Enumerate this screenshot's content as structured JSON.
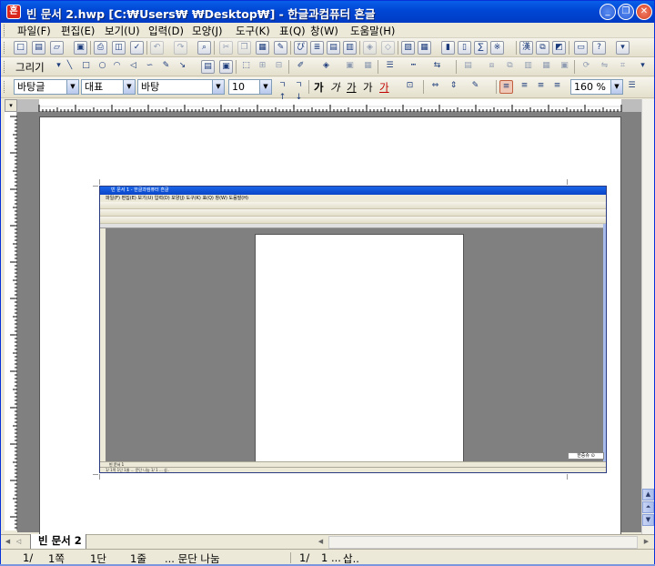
{
  "window": {
    "title": "빈 문서 2.hwp [C:₩Users₩    ₩Desktop₩] - 한글과컴퓨터 흔글",
    "app_icon_letter": "흔"
  },
  "menu": [
    "파일(F)",
    "편집(E)",
    "보기(U)",
    "입력(D)",
    "모양(J)",
    "도구(K)",
    "표(Q)",
    "창(W)",
    "도움말(H)"
  ],
  "toolbar2": {
    "draw_label": "그리기"
  },
  "formatbar": {
    "style": "바탕글",
    "lang_font": "대표",
    "font": "바탕",
    "size": "10",
    "zoom": "160 %",
    "glyphs": [
      "가",
      "가",
      "가",
      "가",
      "가"
    ]
  },
  "tabs": {
    "doc_tab": "빈 문서 2"
  },
  "status": {
    "page": "1/",
    "page_num": "1쪽",
    "section": "1단",
    "line": "1줄",
    "para": "... 문단 나눔",
    "pos": "1/",
    "pos2": "1 ...",
    "mode": "삽.."
  },
  "embedded": {
    "title": "빈 문서 1 - 한글과컴퓨터 흔글",
    "menu": "파일(F) 편집(E) 보기(U) 입력(D) 모양(J) 도구(K) 표(Q) 창(W) 도움말(H)",
    "tab": "빈 문서 1",
    "status": "1/    1쪽    1단    1줄    ... 문단 나눔         1/    1 ... 삽..",
    "lang": "한중슈 ⊙"
  },
  "colors": {
    "titlebar": "#0048d6",
    "chrome": "#ece9d8",
    "workspace": "#808080"
  }
}
